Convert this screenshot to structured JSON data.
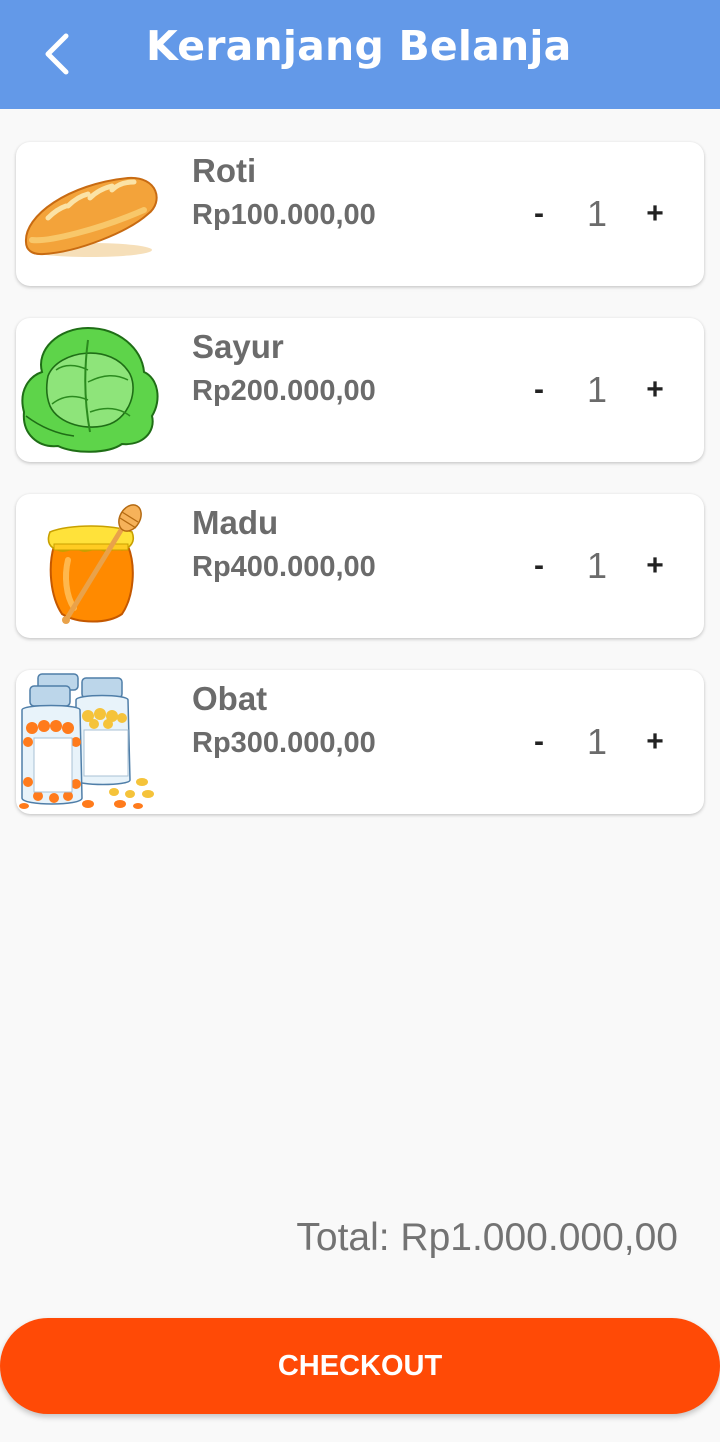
{
  "header": {
    "title": "Keranjang Belanja",
    "back_icon": "chevron-left-icon"
  },
  "items": [
    {
      "name": "Roti",
      "price": "Rp100.000,00",
      "minus": "-",
      "qty": "1",
      "plus": "+",
      "image": "bread-icon"
    },
    {
      "name": "Sayur",
      "price": "Rp200.000,00",
      "minus": "-",
      "qty": "1",
      "plus": "+",
      "image": "cabbage-icon"
    },
    {
      "name": "Madu",
      "price": "Rp400.000,00",
      "minus": "-",
      "qty": "1",
      "plus": "+",
      "image": "honey-jar-icon"
    },
    {
      "name": "Obat",
      "price": "Rp300.000,00",
      "minus": "-",
      "qty": "1",
      "plus": "+",
      "image": "medicine-bottles-icon"
    }
  ],
  "total": "Total: Rp1.000.000,00",
  "checkout_label": "CHECKOUT",
  "colors": {
    "appbar": "#6399e8",
    "checkout": "#ff4a06",
    "background": "#f9f9f9"
  }
}
